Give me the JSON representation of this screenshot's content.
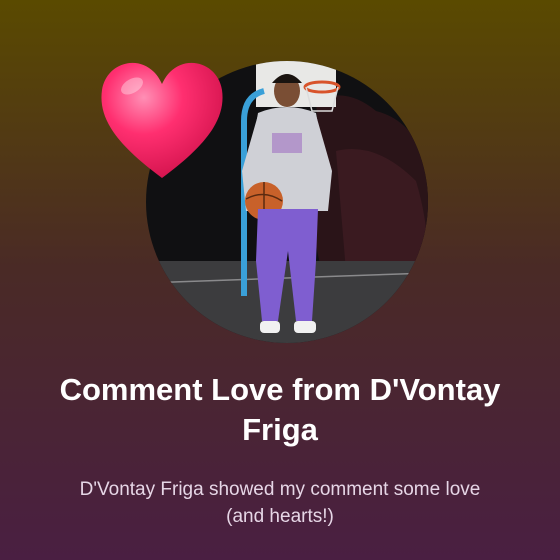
{
  "notification": {
    "title": "Comment Love from D'Vontay Friga",
    "message": "D'Vontay Friga showed my comment some love (and hearts!)"
  },
  "icons": {
    "reaction": "heart-icon"
  },
  "colors": {
    "heart": "#ff2a6a",
    "title": "#ffffff",
    "subtitle": "#e6d6e6"
  }
}
